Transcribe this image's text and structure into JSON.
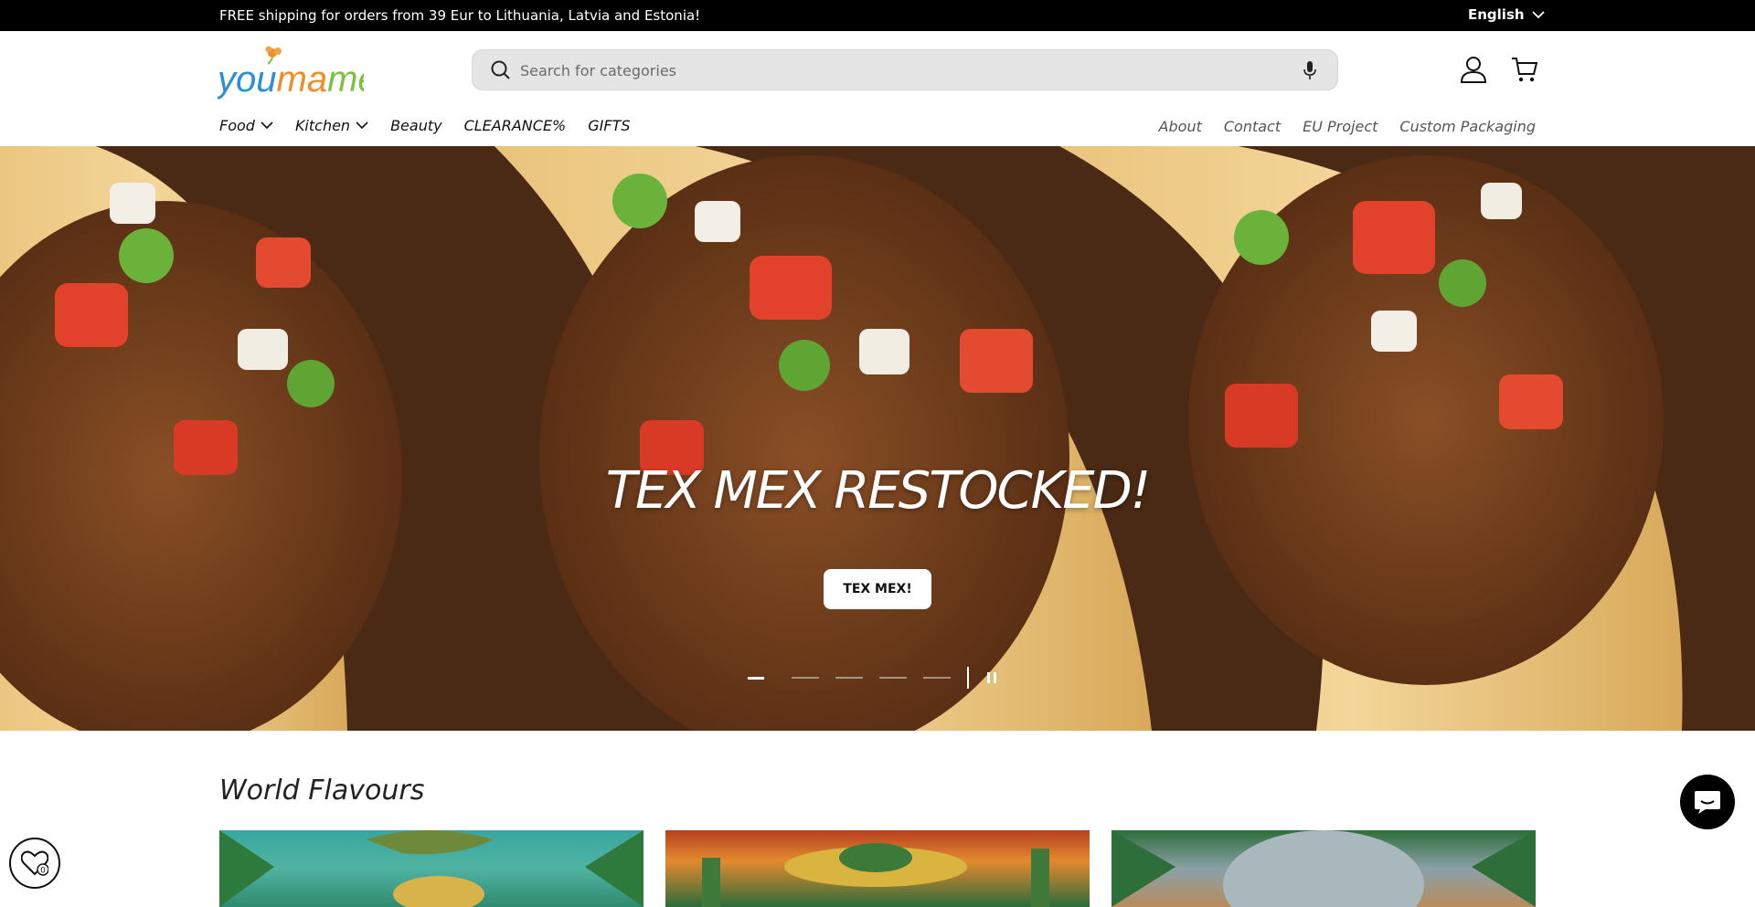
{
  "announcement": {
    "message": "FREE shipping for orders from 39 Eur to Lithuania, Latvia and Estonia!",
    "language": "English"
  },
  "header": {
    "logo_text": "youmame",
    "search_placeholder": "Search for categories",
    "icons": [
      "search-icon",
      "microphone-icon",
      "account-icon",
      "cart-icon"
    ]
  },
  "nav": {
    "left": [
      {
        "label": "Food",
        "has_dropdown": true
      },
      {
        "label": "Kitchen",
        "has_dropdown": true
      },
      {
        "label": "Beauty",
        "has_dropdown": false
      },
      {
        "label": "CLEARANCE%",
        "has_dropdown": false
      },
      {
        "label": "GIFTS",
        "has_dropdown": false
      }
    ],
    "right": [
      {
        "label": "About"
      },
      {
        "label": "Contact"
      },
      {
        "label": "EU Project"
      },
      {
        "label": "Custom Packaging"
      }
    ]
  },
  "hero": {
    "title": "TEX MEX RESTOCKED!",
    "button": "TEX MEX!",
    "slides_count": 5,
    "active_slide": 1
  },
  "section": {
    "title": "World Flavours"
  },
  "widgets": {
    "wishlist_count": "0"
  },
  "colors": {
    "announcement_bg": "#000000",
    "logo_blue": "#2a8fd6",
    "logo_orange": "#f28c28",
    "logo_green": "#7cc242"
  }
}
